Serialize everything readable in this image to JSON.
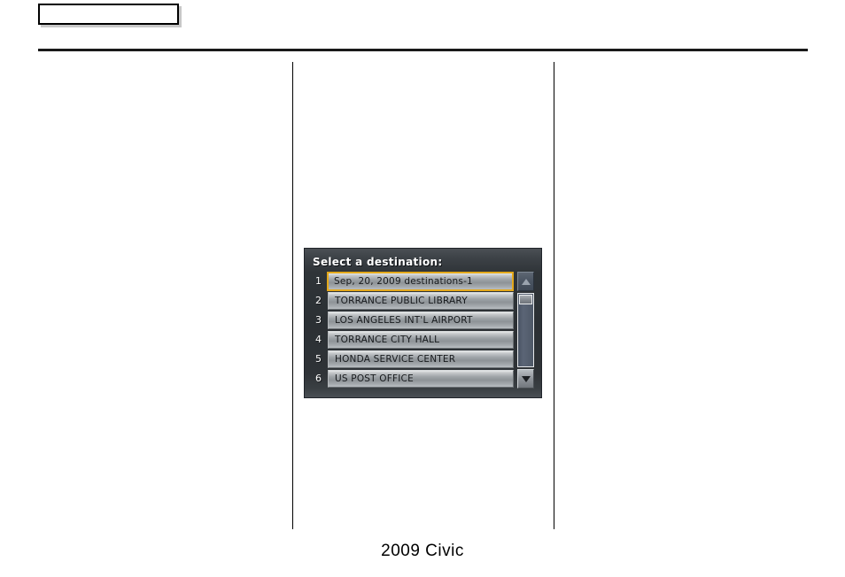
{
  "page": {
    "header_box_label": "",
    "footer_text": "2009  Civic"
  },
  "nav_screen": {
    "title": "Select a destination:",
    "selected_index": 1,
    "accent_color": "#e3a81b",
    "background_color": "#2b3034",
    "button_color": "#9ea3a7",
    "items": [
      {
        "number": "1",
        "label": "Sep, 20, 2009 destinations-1",
        "selected": true
      },
      {
        "number": "2",
        "label": "TORRANCE PUBLIC LIBRARY",
        "selected": false
      },
      {
        "number": "3",
        "label": "LOS ANGELES INT'L AIRPORT",
        "selected": false
      },
      {
        "number": "4",
        "label": "TORRANCE CITY HALL",
        "selected": false
      },
      {
        "number": "5",
        "label": "HONDA SERVICE CENTER",
        "selected": false
      },
      {
        "number": "6",
        "label": "US POST OFFICE",
        "selected": false
      }
    ],
    "scrollbar": {
      "up_icon": "triangle-up-icon",
      "down_icon": "triangle-down-icon",
      "thumb_position_percent": 0
    }
  }
}
